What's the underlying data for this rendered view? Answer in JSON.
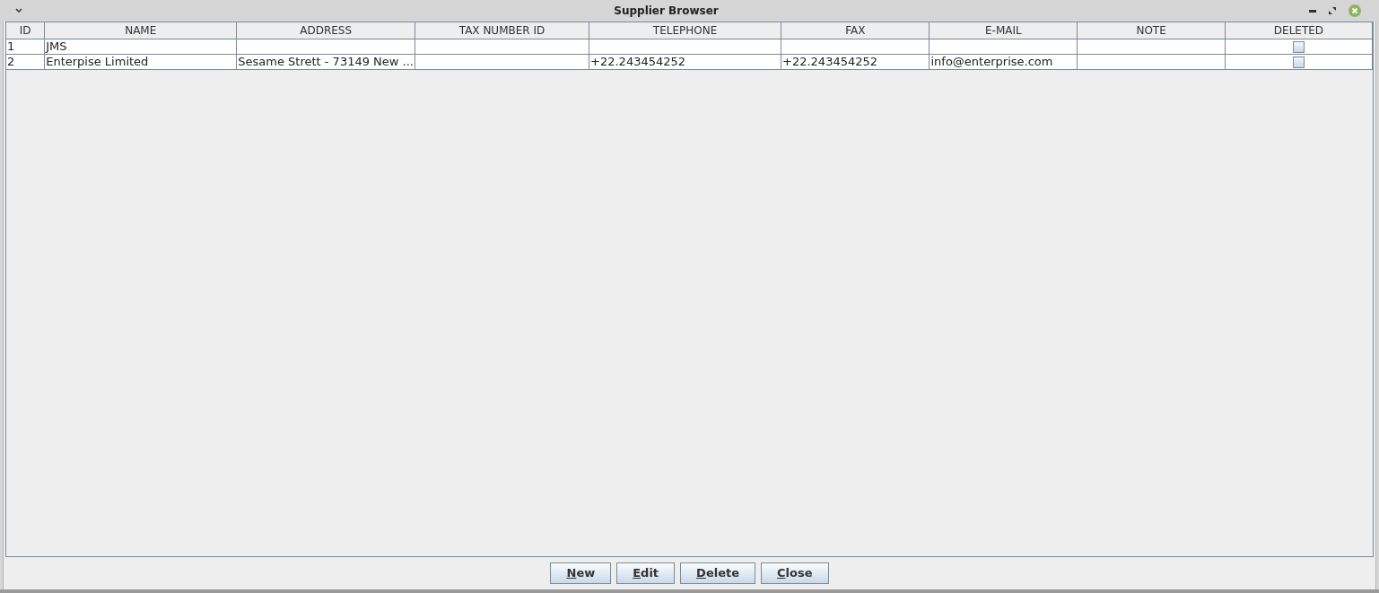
{
  "window": {
    "title": "Supplier Browser"
  },
  "table": {
    "columns": [
      "ID",
      "NAME",
      "ADDRESS",
      "TAX NUMBER ID",
      "TELEPHONE",
      "FAX",
      "E-MAIL",
      "NOTE",
      "DELETED"
    ],
    "rows": [
      {
        "cells": [
          "1",
          "JMS",
          "",
          "",
          "",
          "",
          "",
          ""
        ],
        "deleted": false
      },
      {
        "cells": [
          "2",
          "Enterpise Limited",
          "Sesame Strett - 73149 New ...",
          "",
          "+22.243454252",
          "+22.243454252",
          "info@enterprise.com",
          ""
        ],
        "deleted": false
      }
    ]
  },
  "buttons": [
    "New",
    "Edit",
    "Delete",
    "Close"
  ]
}
